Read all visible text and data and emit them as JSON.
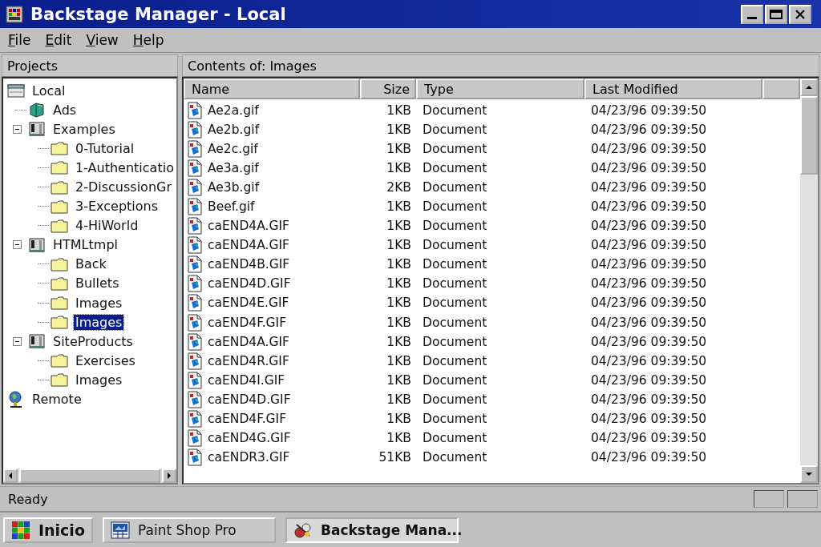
{
  "window": {
    "title": "Backstage Manager - Local"
  },
  "menu": [
    {
      "label": "File"
    },
    {
      "label": "Edit"
    },
    {
      "label": "View"
    },
    {
      "label": "Help"
    }
  ],
  "tree_pane": {
    "title": "Projects",
    "nodes": [
      {
        "label": "Local",
        "kind": "drive",
        "selected": false,
        "children": [
          {
            "label": "Ads",
            "kind": "book",
            "selected": false
          },
          {
            "label": "Examples",
            "kind": "server",
            "expanded": true,
            "selected": false,
            "children": [
              {
                "label": "0-Tutorial",
                "kind": "folder",
                "selected": false
              },
              {
                "label": "1-Authenticatio",
                "kind": "folder",
                "selected": false
              },
              {
                "label": "2-DiscussionGr",
                "kind": "folder",
                "selected": false
              },
              {
                "label": "3-Exceptions",
                "kind": "folder",
                "selected": false
              },
              {
                "label": "4-HiWorld",
                "kind": "folder",
                "selected": false
              }
            ]
          },
          {
            "label": "HTMLtmpl",
            "kind": "server",
            "expanded": true,
            "selected": false,
            "children": [
              {
                "label": "Back",
                "kind": "folder",
                "selected": false
              },
              {
                "label": "Bullets",
                "kind": "folder",
                "selected": false
              },
              {
                "label": "Images",
                "kind": "folder",
                "selected": false
              },
              {
                "label": "Images",
                "kind": "folder",
                "selected": true
              }
            ]
          },
          {
            "label": "SiteProducts",
            "kind": "server",
            "expanded": true,
            "selected": false,
            "children": [
              {
                "label": "Exercises",
                "kind": "folder",
                "selected": false
              },
              {
                "label": "Images",
                "kind": "folder",
                "selected": false
              }
            ]
          }
        ]
      },
      {
        "label": "Remote",
        "kind": "remote",
        "selected": false
      }
    ]
  },
  "list_pane": {
    "title": "Contents of: Images",
    "columns": [
      "Name",
      "Size",
      "Type",
      "Last Modified"
    ],
    "rows": [
      {
        "name": "Ae2a.gif",
        "size": "1KB",
        "type": "Document",
        "modified": "04/23/96 09:39:50"
      },
      {
        "name": "Ae2b.gif",
        "size": "1KB",
        "type": "Document",
        "modified": "04/23/96 09:39:50"
      },
      {
        "name": "Ae2c.gif",
        "size": "1KB",
        "type": "Document",
        "modified": "04/23/96 09:39:50"
      },
      {
        "name": "Ae3a.gif",
        "size": "1KB",
        "type": "Document",
        "modified": "04/23/96 09:39:50"
      },
      {
        "name": "Ae3b.gif",
        "size": "2KB",
        "type": "Document",
        "modified": "04/23/96 09:39:50"
      },
      {
        "name": "Beef.gif",
        "size": "1KB",
        "type": "Document",
        "modified": "04/23/96 09:39:50"
      },
      {
        "name": "caEND4A.GIF",
        "size": "1KB",
        "type": "Document",
        "modified": "04/23/96 09:39:50"
      },
      {
        "name": "caEND4A.GIF",
        "size": "1KB",
        "type": "Document",
        "modified": "04/23/96 09:39:50"
      },
      {
        "name": "caEND4B.GIF",
        "size": "1KB",
        "type": "Document",
        "modified": "04/23/96 09:39:50"
      },
      {
        "name": "caEND4D.GIF",
        "size": "1KB",
        "type": "Document",
        "modified": "04/23/96 09:39:50"
      },
      {
        "name": "caEND4E.GIF",
        "size": "1KB",
        "type": "Document",
        "modified": "04/23/96 09:39:50"
      },
      {
        "name": "caEND4F.GIF",
        "size": "1KB",
        "type": "Document",
        "modified": "04/23/96 09:39:50"
      },
      {
        "name": "caEND4A.GIF",
        "size": "1KB",
        "type": "Document",
        "modified": "04/23/96 09:39:50"
      },
      {
        "name": "caEND4R.GIF",
        "size": "1KB",
        "type": "Document",
        "modified": "04/23/96 09:39:50"
      },
      {
        "name": "caEND4I.GIF",
        "size": "1KB",
        "type": "Document",
        "modified": "04/23/96 09:39:50"
      },
      {
        "name": "caEND4D.GIF",
        "size": "1KB",
        "type": "Document",
        "modified": "04/23/96 09:39:50"
      },
      {
        "name": "caEND4F.GIF",
        "size": "1KB",
        "type": "Document",
        "modified": "04/23/96 09:39:50"
      },
      {
        "name": "caEND4G.GIF",
        "size": "1KB",
        "type": "Document",
        "modified": "04/23/96 09:39:50"
      },
      {
        "name": "caENDR3.GIF",
        "size": "51KB",
        "type": "Document",
        "modified": "04/23/96 09:39:50"
      }
    ]
  },
  "status_bar": {
    "text": "Ready"
  },
  "taskbar": {
    "start": "Inicio",
    "tasks": [
      {
        "label": "Paint Shop Pro",
        "kind": "paint",
        "active": false
      },
      {
        "label": "Backstage Mana...",
        "kind": "backstage",
        "active": true
      }
    ]
  }
}
